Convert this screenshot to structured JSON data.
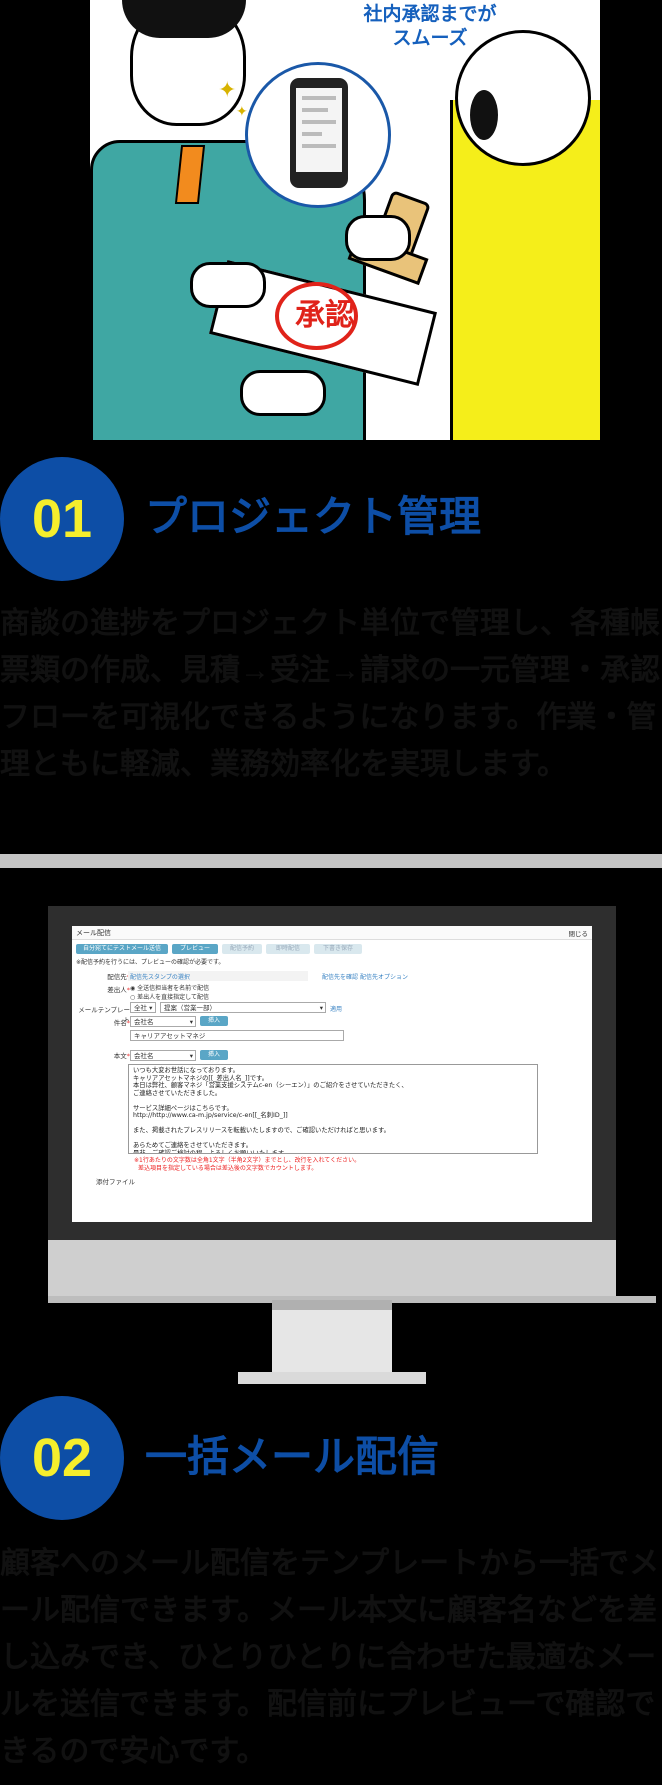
{
  "illustration": {
    "caption_line1": "社内承認までが",
    "caption_line2": "スムーズ",
    "seal_text": "承認",
    "sparkle_icon": "✦"
  },
  "section1": {
    "number": "01",
    "title": "プロジェクト管理",
    "body": "商談の進捗をプロジェクト単位で管理し、各種帳票類の作成、見積→受注→請求の一元管理・承認フローを可視化できるようになります。作業・管理ともに軽減、業務効率化を実現します。"
  },
  "section2": {
    "number": "02",
    "title": "一括メール配信",
    "body": "顧客へのメール配信をテンプレートから一括でメール配信できます。メール本文に顧客名などを差し込みでき、ひとりひとりに合わせた最適なメールを送信できます。配信前にプレビューで確認できるので安心です。"
  },
  "mail": {
    "window_title": "メール配信",
    "close_label": "閉じる",
    "buttons": [
      "自分宛てにテストメール送信",
      "プレビュー",
      "配信予約",
      "即時配信",
      "下書き保存"
    ],
    "note": "※配信予約を行うには、プレビューの確認が必要です。",
    "recipients_label": "配信先",
    "recipients_value": "配信先スタンプの選択",
    "recipients_link1": "配信先を確認",
    "recipients_link2": "配信先オプション",
    "sender_label": "差出人",
    "sender_option1": "全送信担当者を名前で配信",
    "sender_option2": "差出人を直接指定して配信",
    "template_label": "メールテンプレート",
    "template_scope": "全社",
    "template_value": "提案（営業一部）",
    "template_apply": "適用",
    "subject_label": "件名",
    "subject_insert_select": "会社名",
    "subject_insert_button": "挿入",
    "subject_value": "キャリアアセットマネジ",
    "body_label": "本文",
    "body_insert_select": "会社名",
    "body_insert_button": "挿入",
    "body_text": "いつも大変お世話になっております。\nキャリアアセットマネジの[[_差出人名_]]です。\n本日は弊社、顧客マネジ「営業支援システムc-en（シーエン）」のご紹介をさせていただきたく、\nご連絡させていただきました。\n\nサービス詳細ページはこちらです。\nhttp://http://www.ca-m.jp/service/c-en[[_名刺ID_]]\n\nまた、掲載されたプレスリリースを転載いたしますので、ご確認いただければと思います。\n\nあらためてご連絡をさせていただきます。\n是非、ご確認ご検討の程、よろしくお願いいたします。",
    "warning_line1": "※1行あたりの文字数は全角1文字（半角2文字）までとし、改行を入れてください。",
    "warning_line2": "差込項目を指定している場合は差込後の文字数でカウントします。",
    "attachment_label": "添付ファイル"
  }
}
